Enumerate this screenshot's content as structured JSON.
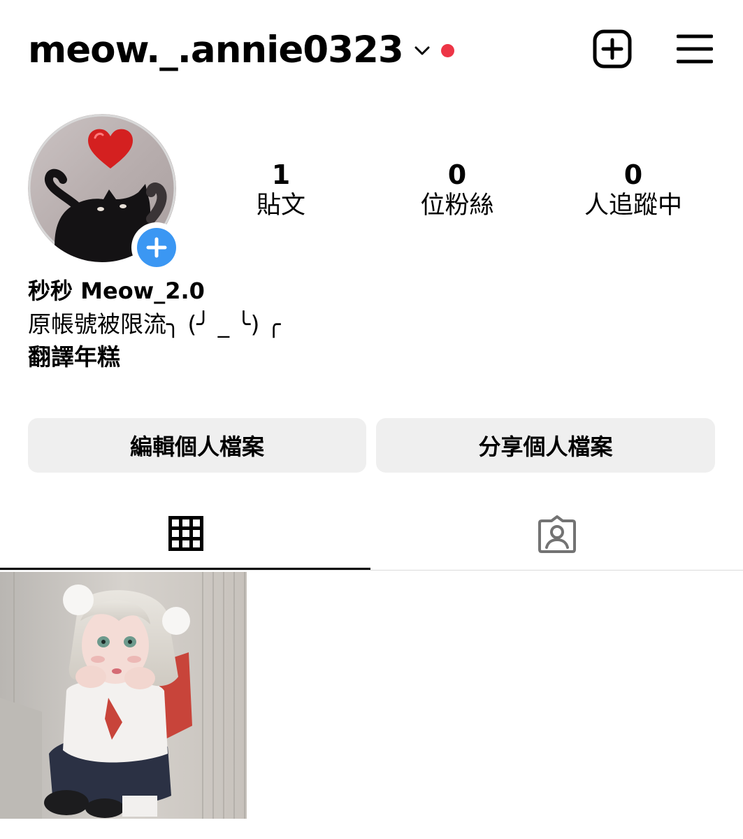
{
  "header": {
    "username": "meow._.annie0323",
    "chevron_icon": "chevron-down-icon",
    "notification_color": "#ed3546",
    "create_icon": "plus-square-icon",
    "menu_icon": "hamburger-menu-icon"
  },
  "profile": {
    "avatar": "profile-photo",
    "add_story_icon": "plus-icon",
    "add_story_color": "#3b97f3",
    "stats": {
      "posts": {
        "count": "1",
        "label": "貼文"
      },
      "followers": {
        "count": "0",
        "label": "位粉絲"
      },
      "following": {
        "count": "0",
        "label": "人追蹤中"
      }
    }
  },
  "bio": {
    "display_name": "秒秒 Meow_2.0",
    "line1": "原帳號被限流╮ (╯ _ ╰) ╭",
    "line2": "翻譯年糕"
  },
  "actions": {
    "edit_profile": "編輯個人檔案",
    "share_profile": "分享個人檔案"
  },
  "tabs": {
    "grid_icon": "grid-icon",
    "tagged_icon": "tagged-person-icon"
  },
  "posts": [
    {
      "thumbnail": "post-photo"
    }
  ]
}
